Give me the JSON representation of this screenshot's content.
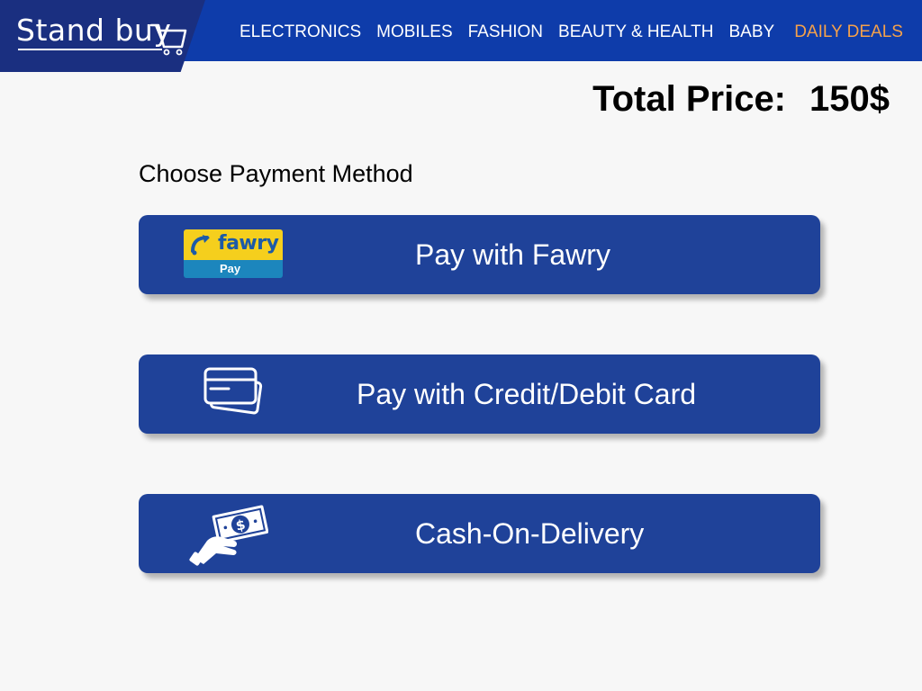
{
  "header": {
    "logo_text": "Stand buy",
    "nav": [
      {
        "label": "ELECTRONICS"
      },
      {
        "label": "MOBILES"
      },
      {
        "label": "FASHION"
      },
      {
        "label": "BEAUTY & HEALTH"
      },
      {
        "label": "BABY"
      },
      {
        "label": "DAILY DEALS"
      }
    ],
    "colors": {
      "bar": "#0e3caa",
      "logo_bg": "#1a2f80",
      "deals": "#f5a14a"
    }
  },
  "total": {
    "label": "Total Price:",
    "value": "150$"
  },
  "payment": {
    "title": "Choose Payment Method",
    "button_color": "#1f4299",
    "methods": [
      {
        "icon": "fawry-pay-logo",
        "label": "Pay with Fawry",
        "logo_word": "fawry",
        "logo_sub": "Pay"
      },
      {
        "icon": "credit-card-icon",
        "label": "Pay with Credit/Debit Card"
      },
      {
        "icon": "cash-hand-icon",
        "label": "Cash-On-Delivery"
      }
    ]
  }
}
